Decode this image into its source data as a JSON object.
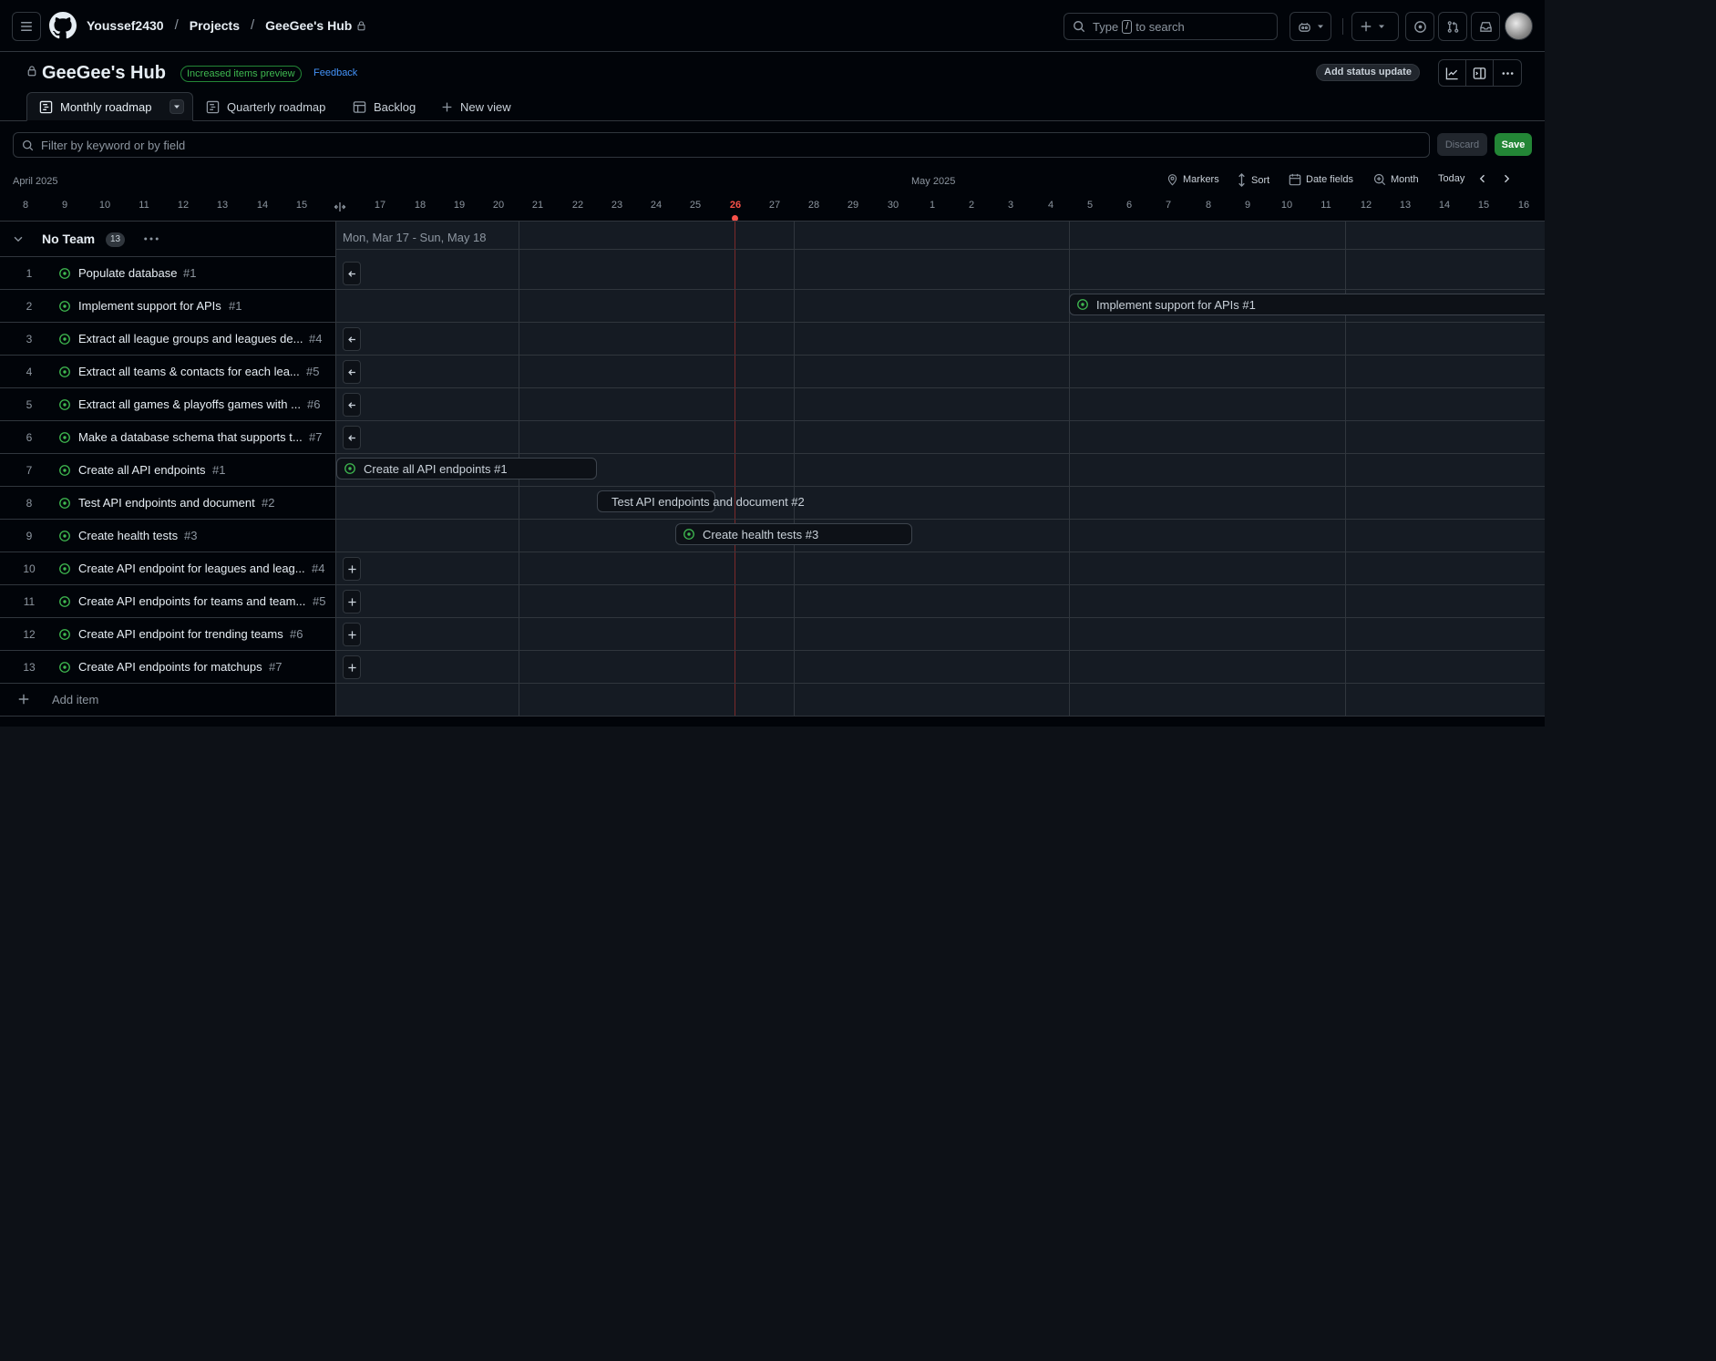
{
  "header": {
    "breadcrumbs": [
      "Youssef2430",
      "Projects",
      "GeeGee's Hub"
    ],
    "search_label": "Type",
    "search_key": "/",
    "search_suffix": "to search"
  },
  "project": {
    "title": "GeeGee's Hub",
    "preview_badge": "Increased items preview",
    "feedback_link": "Feedback",
    "status_button": "Add status update"
  },
  "tabs": [
    {
      "label": "Monthly roadmap",
      "active": true
    },
    {
      "label": "Quarterly roadmap"
    },
    {
      "label": "Backlog"
    },
    {
      "label": "New view"
    }
  ],
  "filter": {
    "placeholder": "Filter by keyword or by field",
    "discard_label": "Discard",
    "save_label": "Save"
  },
  "roadmap": {
    "month_labels": [
      "April 2025",
      "May 2025"
    ],
    "controls": {
      "markers": "Markers",
      "sort": "Sort",
      "date_fields": "Date fields",
      "zoom": "Month",
      "today": "Today"
    },
    "days": [
      "8",
      "9",
      "10",
      "11",
      "12",
      "13",
      "14",
      "15",
      "16",
      "17",
      "18",
      "19",
      "20",
      "21",
      "22",
      "23",
      "24",
      "25",
      "26",
      "27",
      "28",
      "29",
      "30",
      "1",
      "2",
      "3",
      "4",
      "5",
      "6",
      "7",
      "8",
      "9",
      "10",
      "11",
      "12",
      "13",
      "14",
      "15",
      "16"
    ],
    "today_day": "26",
    "range_label": "Mon, Mar 17 - Sun, May 18"
  },
  "group": {
    "name": "No Team",
    "count": "13"
  },
  "items": [
    {
      "num": "1",
      "title": "Populate database",
      "ref": "#1"
    },
    {
      "num": "2",
      "title": "Implement support for APIs",
      "ref": "#1"
    },
    {
      "num": "3",
      "title": "Extract all league groups and leagues de...",
      "ref": "#4"
    },
    {
      "num": "4",
      "title": "Extract all teams & contacts for each lea...",
      "ref": "#5"
    },
    {
      "num": "5",
      "title": "Extract all games & playoffs games with ...",
      "ref": "#6"
    },
    {
      "num": "6",
      "title": "Make a database schema that supports t...",
      "ref": "#7"
    },
    {
      "num": "7",
      "title": "Create all API endpoints",
      "ref": "#1"
    },
    {
      "num": "8",
      "title": "Test API endpoints and document",
      "ref": "#2"
    },
    {
      "num": "9",
      "title": "Create health tests",
      "ref": "#3"
    },
    {
      "num": "10",
      "title": "Create API endpoint for leagues and leag...",
      "ref": "#4"
    },
    {
      "num": "11",
      "title": "Create API endpoints for teams and team...",
      "ref": "#5"
    },
    {
      "num": "12",
      "title": "Create API endpoint for trending teams",
      "ref": "#6"
    },
    {
      "num": "13",
      "title": "Create API endpoints for matchups",
      "ref": "#7"
    }
  ],
  "bars": {
    "implement_support": "Implement support for APIs #1",
    "create_all_endpoints": "Create all API endpoints #1",
    "test_endpoints": "Test API endpoints and document #2",
    "health_tests": "Create health tests #3"
  },
  "add_item_label": "Add item",
  "colors": {
    "accent_open": "#3fb950",
    "save_green": "#238636",
    "today_red": "#f85149",
    "link_blue": "#4493f8"
  },
  "icons": {
    "issue_status": "issue-open-icon",
    "jump_left": "arrow-left-icon",
    "add_date": "plus-icon"
  }
}
